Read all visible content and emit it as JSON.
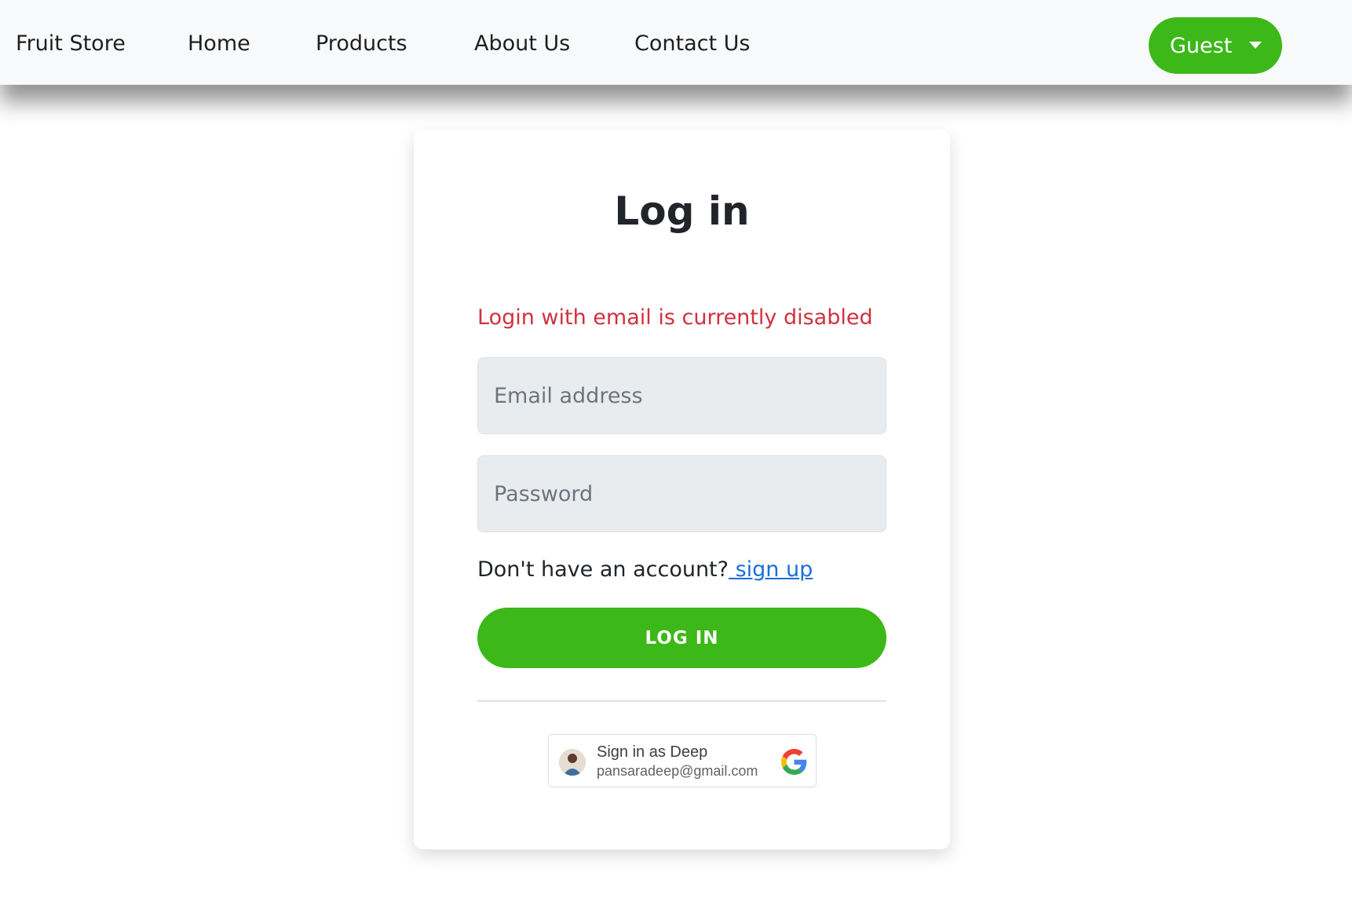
{
  "navbar": {
    "brand": "Fruit Store",
    "links": [
      "Home",
      "Products",
      "About Us",
      "Contact Us"
    ],
    "user_menu_label": "Guest"
  },
  "login": {
    "title": "Log in",
    "error_message": "Login with email is currently disabled",
    "email_placeholder": "Email address",
    "password_placeholder": "Password",
    "signup_prompt": "Don't have an account?",
    "signup_link": " sign up",
    "submit_label": "LOG IN"
  },
  "google_signin": {
    "title": "Sign in as Deep",
    "email": "pansaradeep@gmail.com"
  },
  "colors": {
    "accent_green": "#3cb818",
    "error_red": "#d0313f",
    "link_blue": "#1a6fd6",
    "navbar_bg": "#f8f9fa",
    "input_bg": "#e9ecef"
  }
}
